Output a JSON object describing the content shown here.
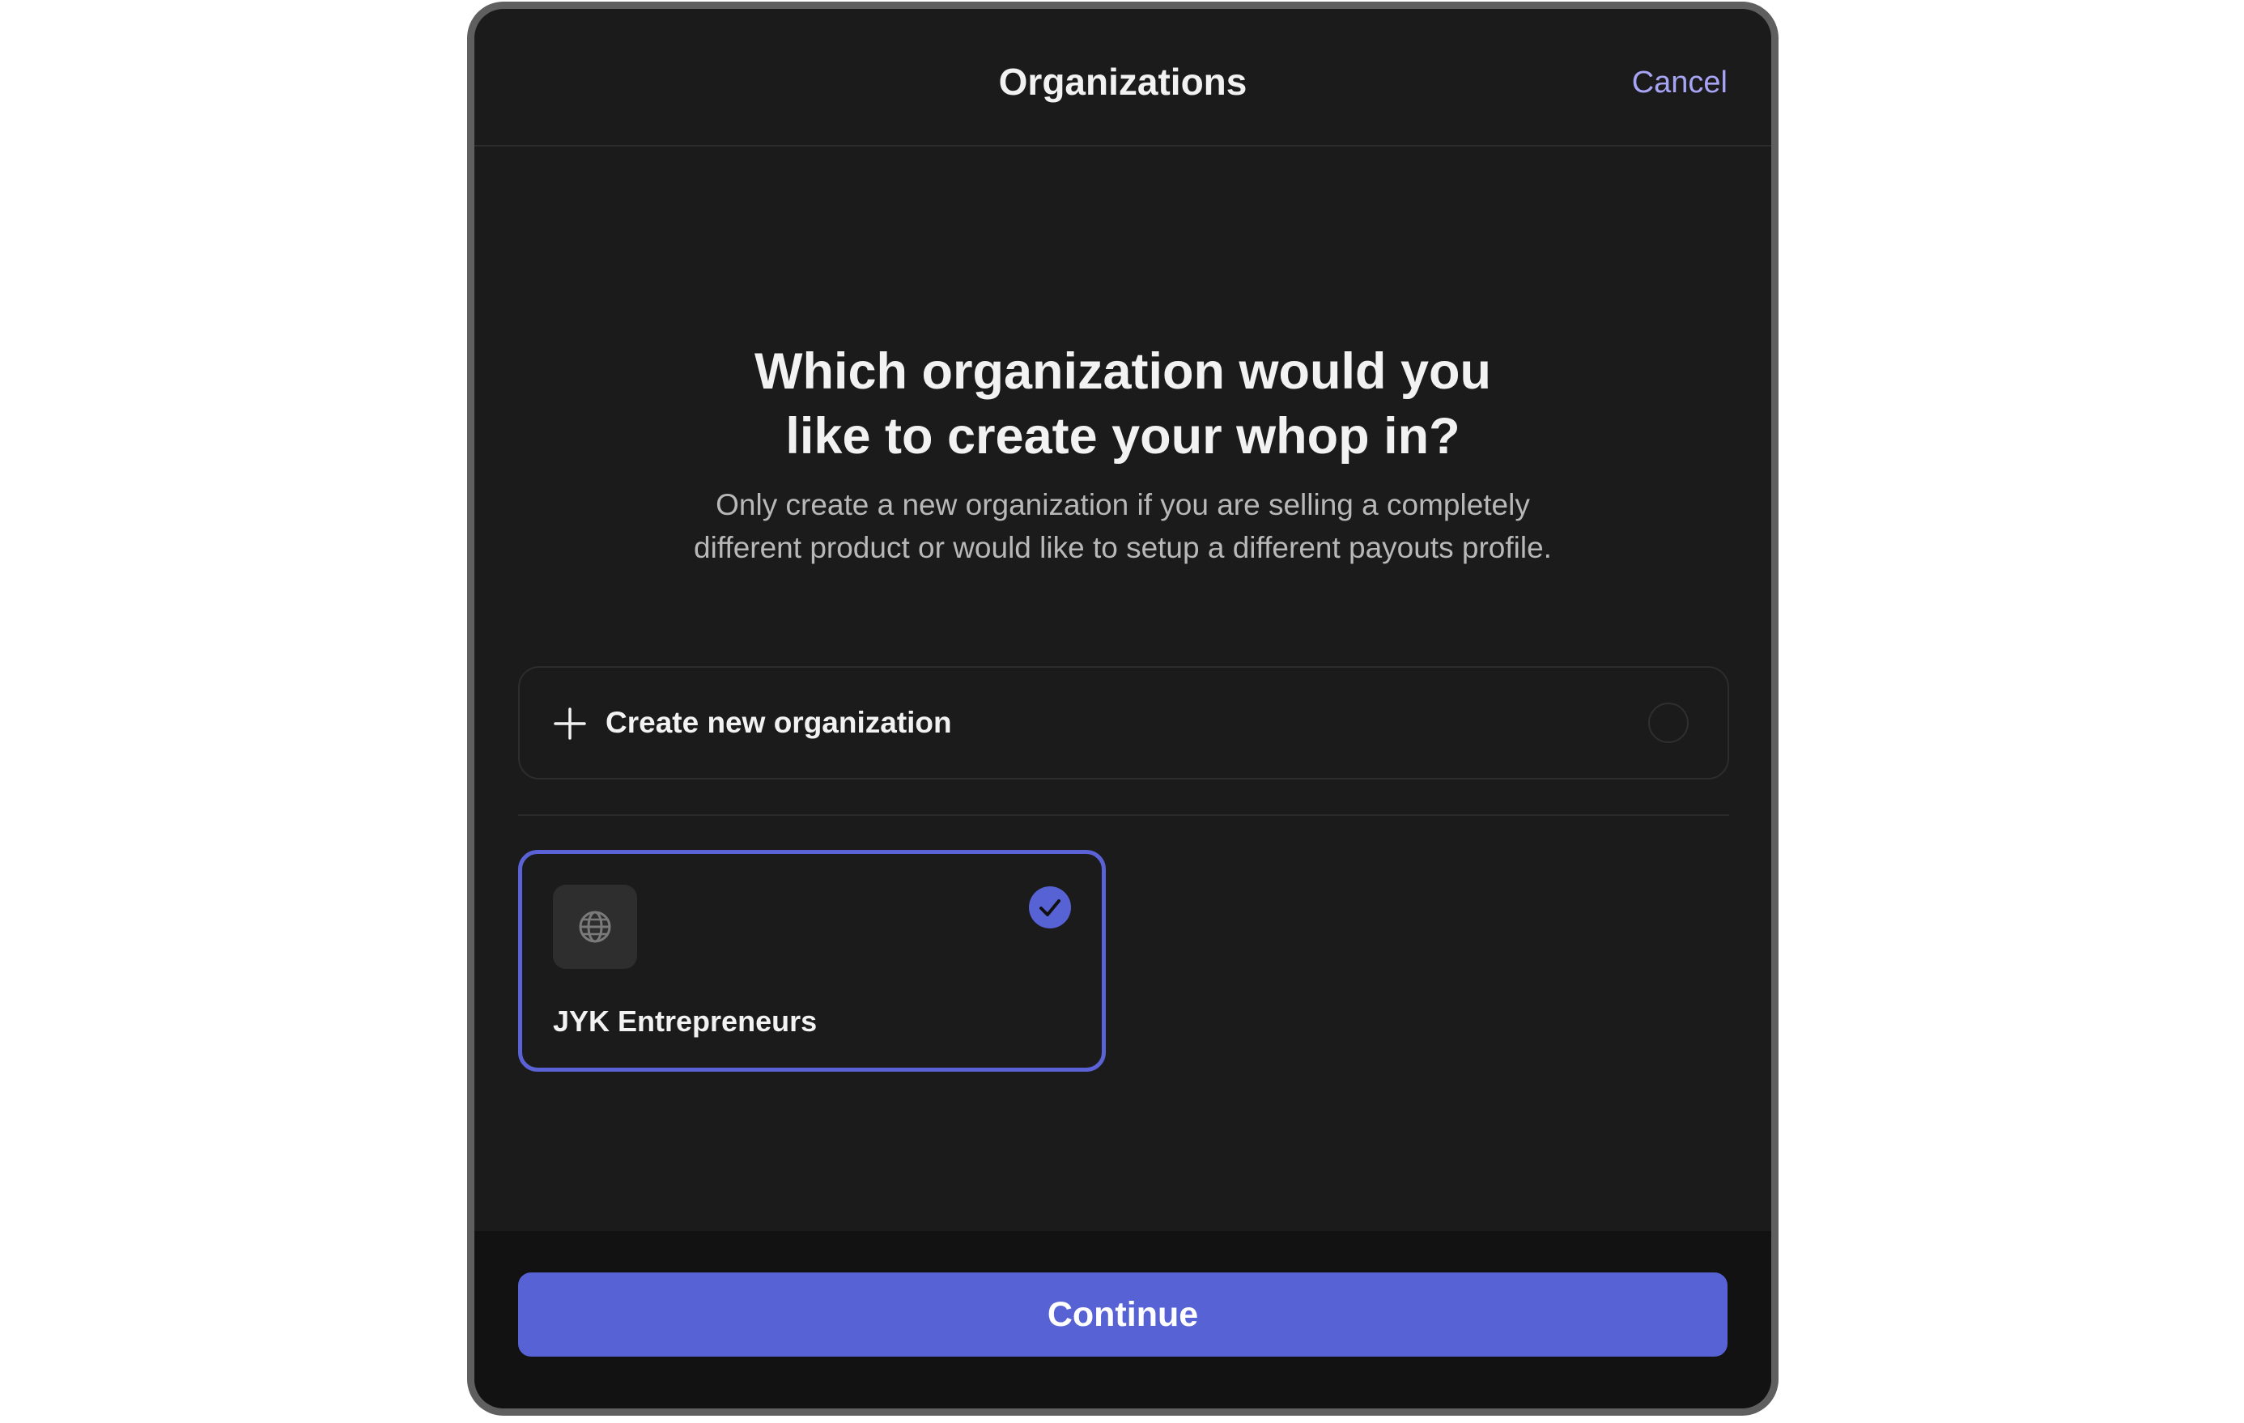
{
  "header": {
    "title": "Organizations",
    "cancel_label": "Cancel"
  },
  "main": {
    "heading_line1": "Which organization would you",
    "heading_line2": "like to create your whop in?",
    "subtext_line1": "Only create a new organization if you are selling a completely",
    "subtext_line2": "different product or would like to setup a different payouts profile."
  },
  "create_option": {
    "label": "Create new organization",
    "icon": "plus-icon",
    "selected": false
  },
  "organizations": [
    {
      "name": "JYK Entrepreneurs",
      "icon": "globe-icon",
      "selected": true
    }
  ],
  "footer": {
    "continue_label": "Continue"
  },
  "colors": {
    "accent": "#5762d5",
    "cancel_link": "#a8a4f5",
    "modal_background": "#1b1b1b",
    "footer_background": "#121212",
    "text_primary": "#f2f2f2",
    "text_secondary": "#b8b8b8"
  }
}
